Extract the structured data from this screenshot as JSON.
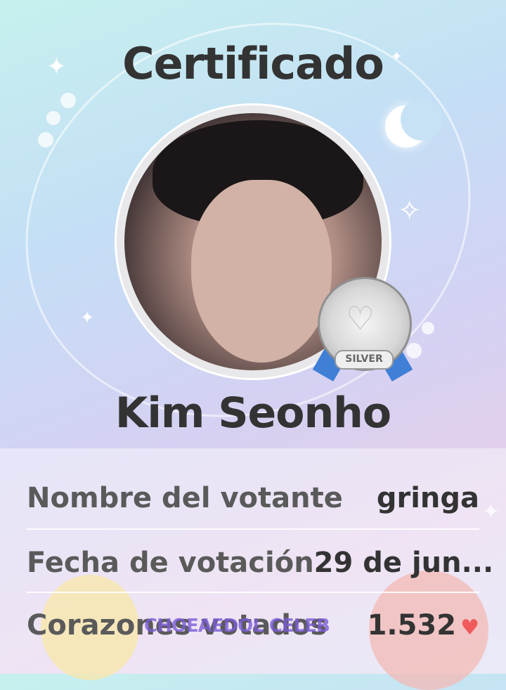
{
  "certificate": {
    "title": "Certificado",
    "celebrity_name": "Kim Seonho",
    "badge": {
      "tier_label": "SILVER",
      "color": "#b5b5b5",
      "ribbon_color": "#3f7fd6"
    },
    "rows": [
      {
        "label": "Nombre del votante",
        "value": "gringa"
      },
      {
        "label": "Fecha de votación",
        "value": "29 de jun..."
      },
      {
        "label": "Corazones votados",
        "value": "1.532"
      }
    ],
    "heart_icon": "heart-icon",
    "heart_color": "#ef5b5b",
    "watermark": "CHOEAEDOL CELEB"
  }
}
